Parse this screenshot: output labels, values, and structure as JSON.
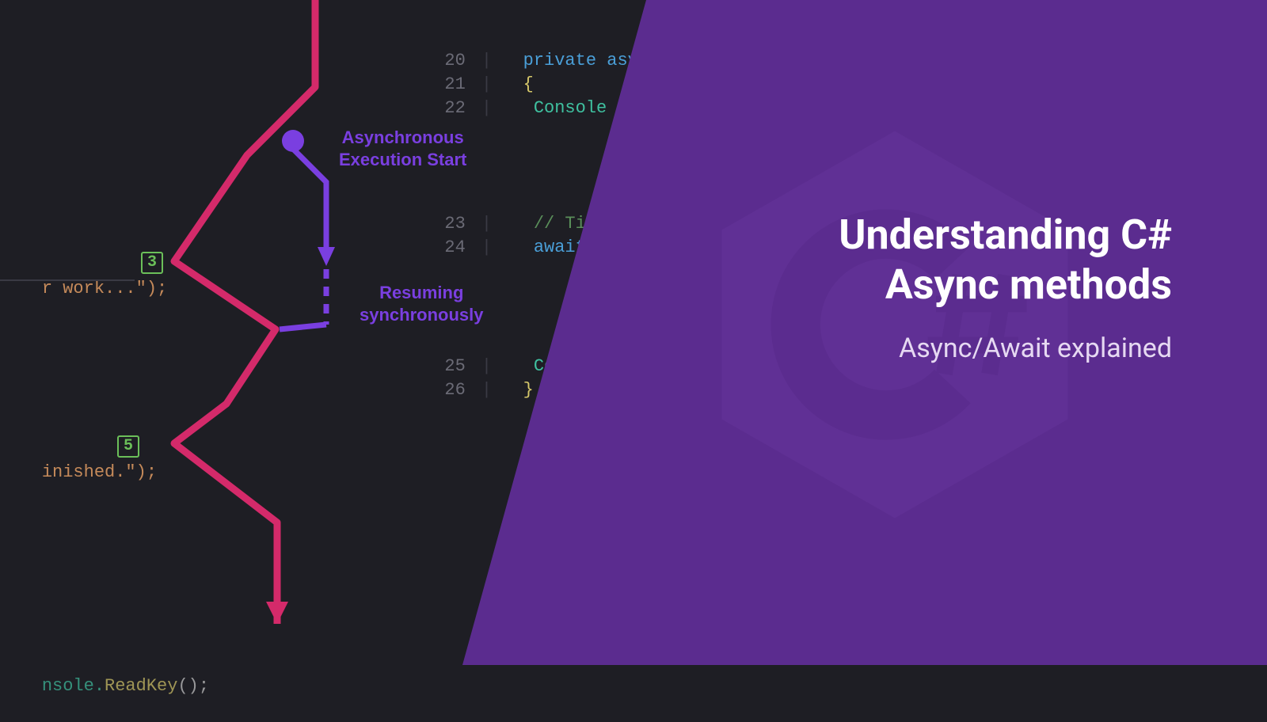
{
  "title_line1": "Understanding C#",
  "title_line2": "Async methods",
  "subtitle": "Async/Await explained",
  "annotations": {
    "async_start_l1": "Asynchronous",
    "async_start_l2": "Execution Start",
    "resuming_l1": "Resuming",
    "resuming_l2": "synchronously"
  },
  "badges": {
    "b3": "3",
    "b5": "5"
  },
  "code": {
    "l20_num": "20",
    "l20_kw1": "private",
    "l20_kw2": "asyn",
    "l21_num": "21",
    "l21_brace": "{",
    "l22_num": "22",
    "l22_obj": "Console",
    "l23_num": "23",
    "l23_comment": "// Tim",
    "l24_num": "24",
    "l24_kw": "await",
    "l25_num": "25",
    "l25_obj": "Cons",
    "l26_num": "26",
    "l26_brace": "}",
    "frag_work": "r work...\");",
    "frag_finished": "inished.\");",
    "frag_readkey_pre": "nsole.",
    "frag_readkey_call": "ReadKey",
    "frag_readkey_post": "();"
  }
}
